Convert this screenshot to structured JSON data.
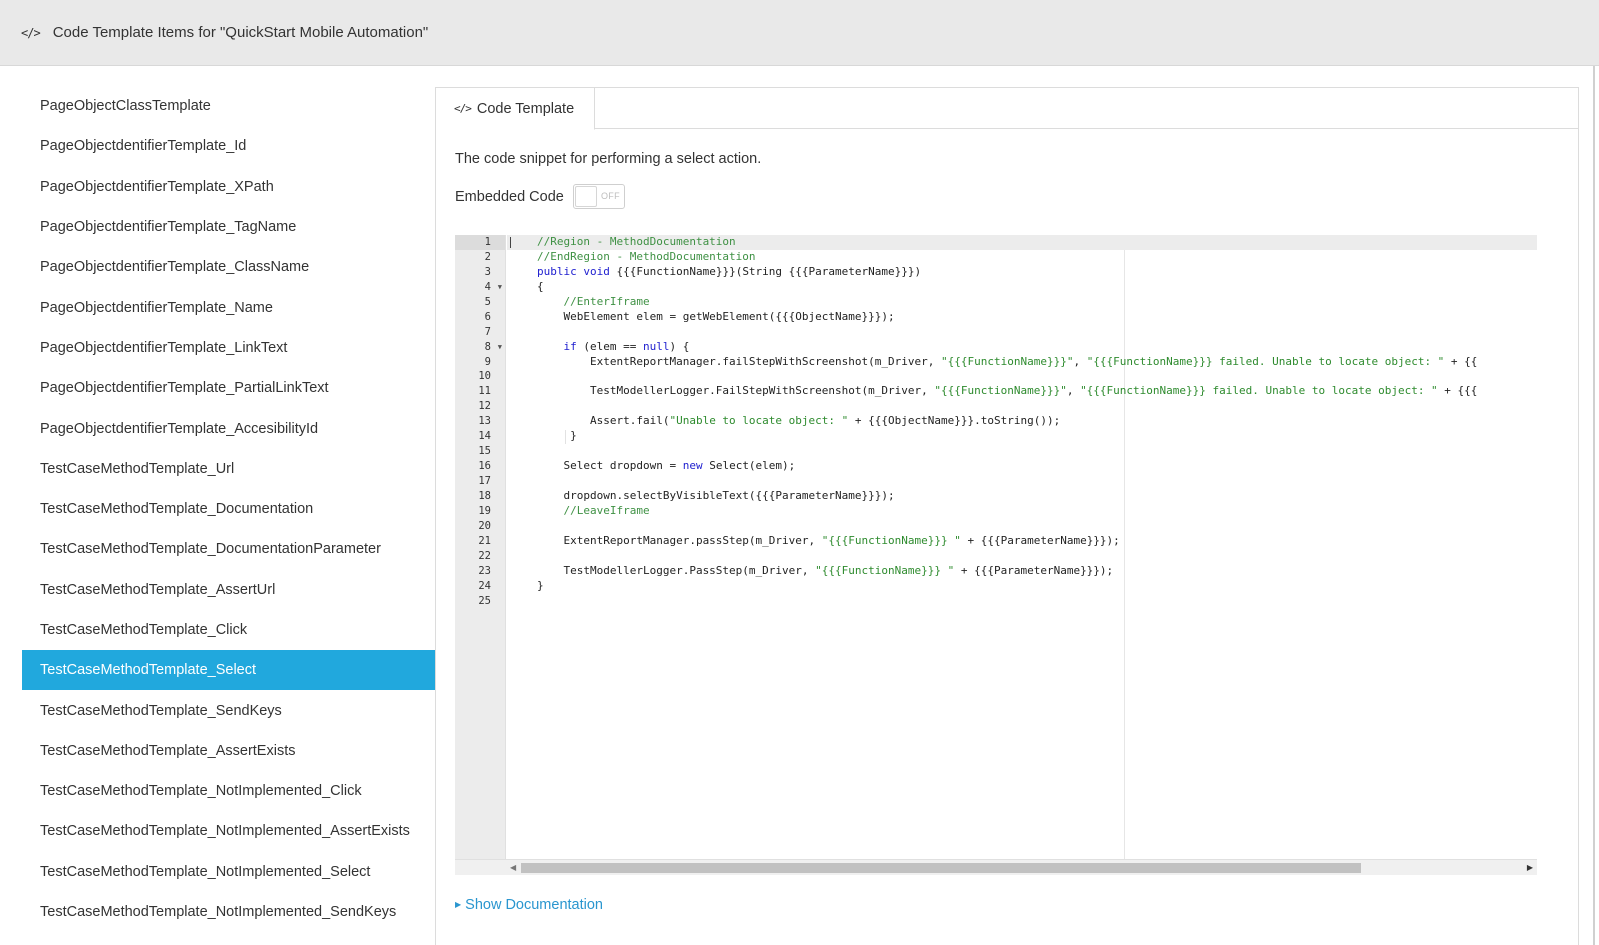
{
  "header": {
    "icon": "code-icon",
    "title": "Code Template Items for \"QuickStart Mobile Automation\""
  },
  "sidebar": {
    "items": [
      "PageObjectClassTemplate",
      "PageObjectdentifierTemplate_Id",
      "PageObjectdentifierTemplate_XPath",
      "PageObjectdentifierTemplate_TagName",
      "PageObjectdentifierTemplate_ClassName",
      "PageObjectdentifierTemplate_Name",
      "PageObjectdentifierTemplate_LinkText",
      "PageObjectdentifierTemplate_PartialLinkText",
      "PageObjectdentifierTemplate_AccesibilityId",
      "TestCaseMethodTemplate_Url",
      "TestCaseMethodTemplate_Documentation",
      "TestCaseMethodTemplate_DocumentationParameter",
      "TestCaseMethodTemplate_AssertUrl",
      "TestCaseMethodTemplate_Click",
      "TestCaseMethodTemplate_Select",
      "TestCaseMethodTemplate_SendKeys",
      "TestCaseMethodTemplate_AssertExists",
      "TestCaseMethodTemplate_NotImplemented_Click",
      "TestCaseMethodTemplate_NotImplemented_AssertExists",
      "TestCaseMethodTemplate_NotImplemented_Select",
      "TestCaseMethodTemplate_NotImplemented_SendKeys"
    ],
    "active_index": 14,
    "active_color": "#21a8dd"
  },
  "panel": {
    "tab_label": "Code Template",
    "tab_icon": "code-icon",
    "description": "The code snippet for performing a select action.",
    "embedded_label": "Embedded Code",
    "toggle_state": "OFF",
    "show_documentation": "Show Documentation",
    "link_color": "#2a96cf"
  },
  "editor": {
    "line_numbers": [
      "1",
      "2",
      "3",
      "4",
      "5",
      "6",
      "7",
      "8",
      "9",
      "10",
      "11",
      "12",
      "13",
      "14",
      "15",
      "16",
      "17",
      "18",
      "19",
      "20",
      "21",
      "22",
      "23",
      "24",
      "25"
    ],
    "fold_lines": [
      4,
      8
    ],
    "lines": [
      [
        {
          "t": "c",
          "v": "//Region - MethodDocumentation"
        }
      ],
      [
        {
          "t": "c",
          "v": "//EndRegion - MethodDocumentation"
        }
      ],
      [
        {
          "t": "k",
          "v": "public void "
        },
        {
          "t": "p",
          "v": "{{{FunctionName}}}(String {{{ParameterName}}})"
        }
      ],
      [
        {
          "t": "p",
          "v": "{"
        }
      ],
      [
        {
          "t": "c",
          "v": "    //EnterIframe"
        }
      ],
      [
        {
          "t": "p",
          "v": "    WebElement elem = getWebElement({{{ObjectName}}});"
        }
      ],
      [
        {
          "t": "p",
          "v": ""
        }
      ],
      [
        {
          "t": "k",
          "v": "    if "
        },
        {
          "t": "p",
          "v": "(elem == "
        },
        {
          "t": "k",
          "v": "null"
        },
        {
          "t": "p",
          "v": ") {"
        }
      ],
      [
        {
          "t": "p",
          "v": "        ExtentReportManager.failStepWithScreenshot(m_Driver, "
        },
        {
          "t": "s",
          "v": "\"{{{FunctionName}}}\""
        },
        {
          "t": "p",
          "v": ", "
        },
        {
          "t": "s",
          "v": "\"{{{FunctionName}}} failed. Unable to locate object: \""
        },
        {
          "t": "p",
          "v": " + {{"
        }
      ],
      [
        {
          "t": "p",
          "v": ""
        }
      ],
      [
        {
          "t": "p",
          "v": "        TestModellerLogger.FailStepWithScreenshot(m_Driver, "
        },
        {
          "t": "s",
          "v": "\"{{{FunctionName}}}\""
        },
        {
          "t": "p",
          "v": ", "
        },
        {
          "t": "s",
          "v": "\"{{{FunctionName}}} failed. Unable to locate object: \""
        },
        {
          "t": "p",
          "v": " + {{{"
        }
      ],
      [
        {
          "t": "p",
          "v": ""
        }
      ],
      [
        {
          "t": "p",
          "v": "        Assert.fail("
        },
        {
          "t": "s",
          "v": "\"Unable to locate object: \""
        },
        {
          "t": "p",
          "v": " + {{{ObjectName}}}.toString());"
        }
      ],
      [
        {
          "t": "p",
          "v": "     }"
        }
      ],
      [
        {
          "t": "p",
          "v": ""
        }
      ],
      [
        {
          "t": "p",
          "v": "    Select dropdown = "
        },
        {
          "t": "k",
          "v": "new"
        },
        {
          "t": "p",
          "v": " Select(elem);"
        }
      ],
      [
        {
          "t": "p",
          "v": ""
        }
      ],
      [
        {
          "t": "p",
          "v": "    dropdown.selectByVisibleText({{{ParameterName}}});"
        }
      ],
      [
        {
          "t": "c",
          "v": "    //LeaveIframe"
        }
      ],
      [
        {
          "t": "p",
          "v": ""
        }
      ],
      [
        {
          "t": "p",
          "v": "    ExtentReportManager.passStep(m_Driver, "
        },
        {
          "t": "s",
          "v": "\"{{{FunctionName}}} \""
        },
        {
          "t": "p",
          "v": " + {{{ParameterName}}});"
        }
      ],
      [
        {
          "t": "p",
          "v": ""
        }
      ],
      [
        {
          "t": "p",
          "v": "    TestModellerLogger.PassStep(m_Driver, "
        },
        {
          "t": "s",
          "v": "\"{{{FunctionName}}} \""
        },
        {
          "t": "p",
          "v": " + {{{ParameterName}}});"
        }
      ],
      [
        {
          "t": "p",
          "v": "}"
        }
      ],
      [
        {
          "t": "p",
          "v": ""
        }
      ]
    ]
  }
}
